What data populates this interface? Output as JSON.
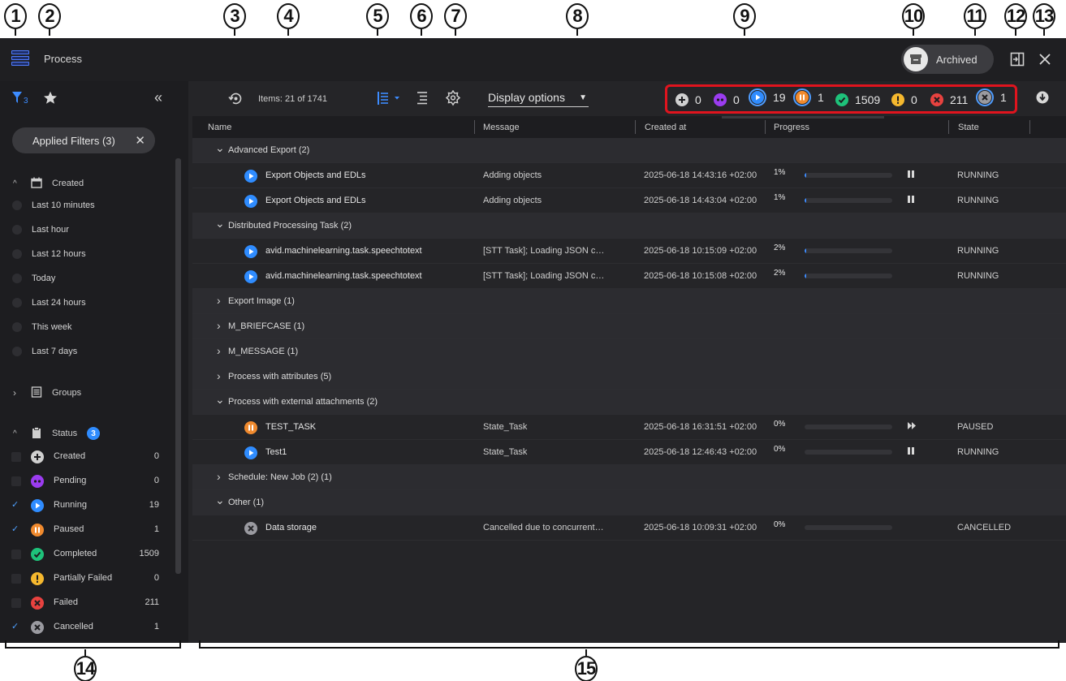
{
  "callouts": [
    "1",
    "2",
    "3",
    "4",
    "5",
    "6",
    "7",
    "8",
    "9",
    "10",
    "11",
    "12",
    "13",
    "14",
    "15"
  ],
  "app": {
    "title": "Process",
    "archived_label": "Archived"
  },
  "sidebar": {
    "filter_count": "3",
    "applied_filters": "Applied Filters (3)",
    "created_section": "Created",
    "time_filters": [
      "Last 10 minutes",
      "Last hour",
      "Last 12 hours",
      "Today",
      "Last 24 hours",
      "This week",
      "Last 7 days"
    ],
    "groups_section": "Groups",
    "status_section": "Status",
    "status_badge": "3",
    "statuses": [
      {
        "label": "Created",
        "count": "0",
        "checked": false,
        "color": "#d0d0d0",
        "icon": "plus-icon"
      },
      {
        "label": "Pending",
        "count": "0",
        "checked": false,
        "color": "#9b3cf0",
        "icon": "pending-icon"
      },
      {
        "label": "Running",
        "count": "19",
        "checked": true,
        "color": "#2f8cff",
        "icon": "play-icon"
      },
      {
        "label": "Paused",
        "count": "1",
        "checked": true,
        "color": "#f08a2e",
        "icon": "pause-icon"
      },
      {
        "label": "Completed",
        "count": "1509",
        "checked": false,
        "color": "#1ec27a",
        "icon": "check-icon"
      },
      {
        "label": "Partially Failed",
        "count": "0",
        "checked": false,
        "color": "#f5b82e",
        "icon": "exclamation-icon"
      },
      {
        "label": "Failed",
        "count": "211",
        "checked": false,
        "color": "#e8423f",
        "icon": "x-icon"
      },
      {
        "label": "Cancelled",
        "count": "1",
        "checked": true,
        "color": "#9a9aa0",
        "icon": "cancel-icon"
      }
    ]
  },
  "toolbar": {
    "items_label": "Items: 21 of 1741",
    "display_options": "Display options"
  },
  "summary": [
    {
      "icon": "plus-icon",
      "count": "0",
      "color": "#d0d0d0"
    },
    {
      "icon": "pending-icon",
      "count": "0",
      "color": "#9b3cf0"
    },
    {
      "icon": "play-icon",
      "count": "19",
      "color": "#2f8cff"
    },
    {
      "icon": "pause-icon",
      "count": "1",
      "color": "#f08a2e"
    },
    {
      "icon": "check-icon",
      "count": "1509",
      "color": "#1ec27a"
    },
    {
      "icon": "exclamation-icon",
      "count": "0",
      "color": "#f5b82e"
    },
    {
      "icon": "x-icon",
      "count": "211",
      "color": "#e8423f"
    },
    {
      "icon": "cancel-icon",
      "count": "1",
      "color": "#9a9aa0"
    }
  ],
  "table": {
    "columns": [
      "Name",
      "Message",
      "Created at",
      "Progress",
      "State"
    ],
    "rows": [
      {
        "type": "group",
        "open": true,
        "name": "Advanced Export (2)"
      },
      {
        "type": "item",
        "icon": "play-icon",
        "name": "Export Objects and EDLs",
        "message": "Adding objects",
        "date": "2025-06-18 14:43:16 +02:00",
        "pct": "1%",
        "progress": 1,
        "action": "pause-icon",
        "state": "RUNNING"
      },
      {
        "type": "item",
        "icon": "play-icon",
        "name": "Export Objects and EDLs",
        "message": "Adding objects",
        "date": "2025-06-18 14:43:04 +02:00",
        "pct": "1%",
        "progress": 1,
        "action": "pause-icon",
        "state": "RUNNING"
      },
      {
        "type": "group",
        "open": true,
        "name": "Distributed Processing Task (2)"
      },
      {
        "type": "item",
        "icon": "play-icon",
        "name": "avid.machinelearning.task.speechtotext",
        "message": "[STT Task]; Loading JSON c…",
        "date": "2025-06-18 10:15:09 +02:00",
        "pct": "2%",
        "progress": 2,
        "action": "",
        "state": "RUNNING"
      },
      {
        "type": "item",
        "icon": "play-icon",
        "name": "avid.machinelearning.task.speechtotext",
        "message": "[STT Task]; Loading JSON c…",
        "date": "2025-06-18 10:15:08 +02:00",
        "pct": "2%",
        "progress": 2,
        "action": "",
        "state": "RUNNING"
      },
      {
        "type": "group",
        "open": false,
        "name": "Export Image (1)"
      },
      {
        "type": "group",
        "open": false,
        "name": "M_BRIEFCASE (1)"
      },
      {
        "type": "group",
        "open": false,
        "name": "M_MESSAGE (1)"
      },
      {
        "type": "group",
        "open": false,
        "name": "Process with attributes (5)"
      },
      {
        "type": "group",
        "open": true,
        "name": "Process with external attachments (2)"
      },
      {
        "type": "item",
        "icon": "pause-icon",
        "name": "TEST_TASK",
        "message": "State_Task",
        "date": "2025-06-18 16:31:51 +02:00",
        "pct": "0%",
        "progress": 0,
        "action": "resume-icon",
        "state": "PAUSED"
      },
      {
        "type": "item",
        "icon": "play-icon",
        "name": "Test1",
        "message": "State_Task",
        "date": "2025-06-18 12:46:43 +02:00",
        "pct": "0%",
        "progress": 0,
        "action": "pause-icon",
        "state": "RUNNING"
      },
      {
        "type": "group",
        "open": false,
        "name": "Schedule: New Job (2) (1)"
      },
      {
        "type": "group",
        "open": true,
        "name": "Other (1)"
      },
      {
        "type": "item",
        "icon": "cancel-icon",
        "name": "Data storage",
        "message": "Cancelled due to concurrent…",
        "date": "2025-06-18 10:09:31 +02:00",
        "pct": "0%",
        "progress": 0,
        "action": "",
        "state": "CANCELLED"
      }
    ]
  }
}
